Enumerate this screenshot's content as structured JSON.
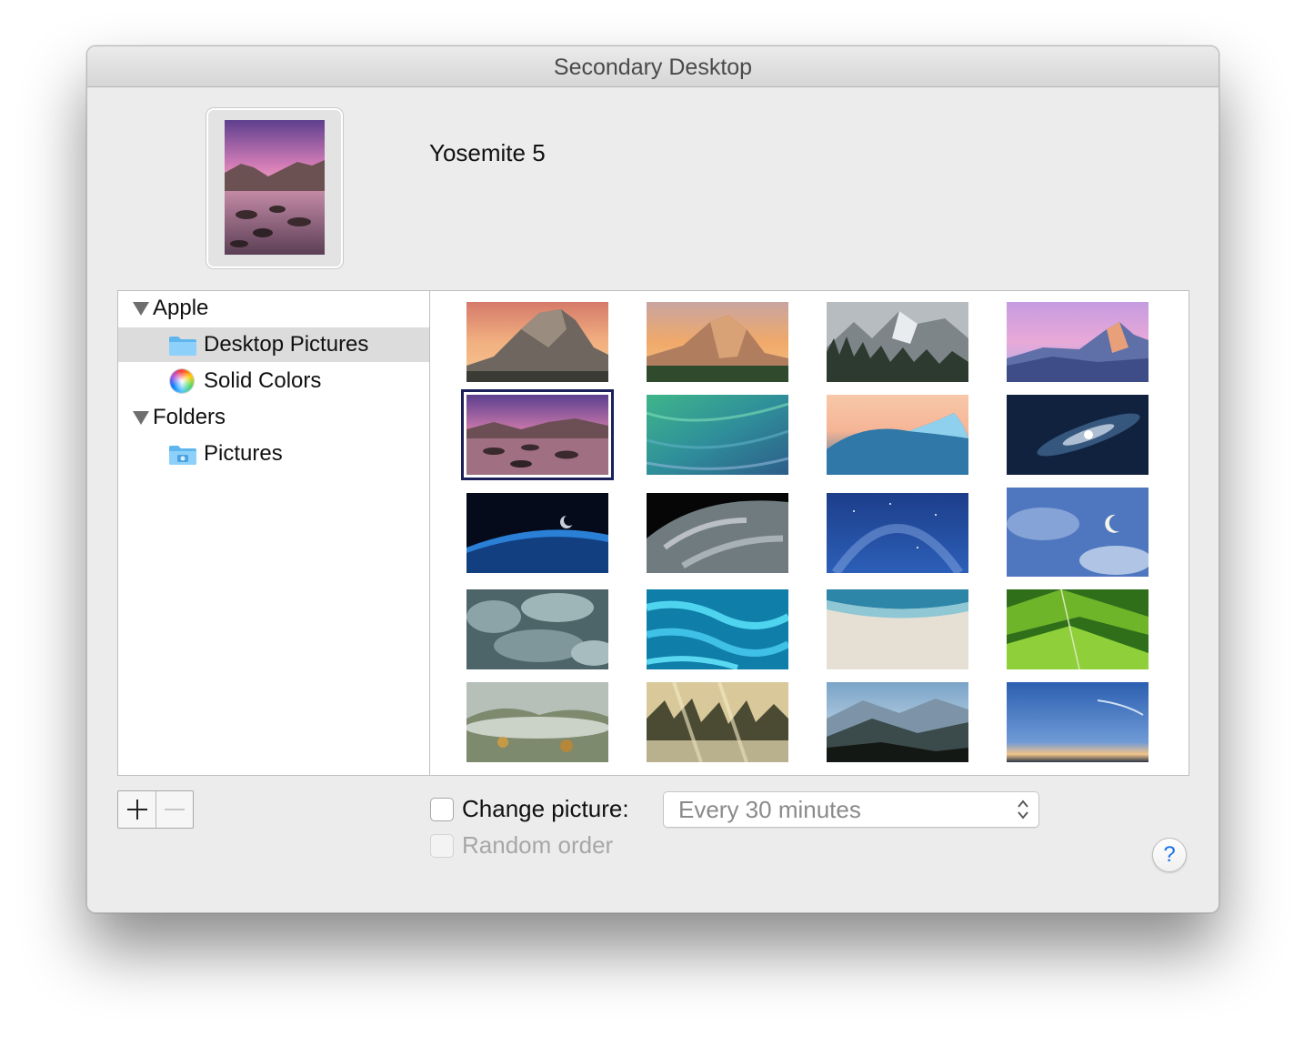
{
  "window": {
    "title": "Secondary Desktop"
  },
  "preview": {
    "name": "Yosemite 5"
  },
  "sources": [
    {
      "label": "Apple",
      "type": "group"
    },
    {
      "label": "Desktop Pictures",
      "type": "folder",
      "selected": true
    },
    {
      "label": "Solid Colors",
      "type": "colors"
    },
    {
      "label": "Folders",
      "type": "group"
    },
    {
      "label": "Pictures",
      "type": "folder"
    }
  ],
  "icons": {
    "disclosure": "disclosure-triangle-icon",
    "folder": "folder-icon",
    "pictures_folder": "pictures-folder-icon",
    "color_wheel": "color-wheel-icon",
    "add": "plus-icon",
    "remove": "minus-icon",
    "stepper": "up-down-arrows-icon"
  },
  "thumbnails": [
    {
      "theme": "yosemite-halfdome-sunset",
      "selected": false
    },
    {
      "theme": "yosemite-elcapitan-sunset",
      "selected": false
    },
    {
      "theme": "yosemite-snow-valley",
      "selected": false
    },
    {
      "theme": "yosemite-halfdome-purple",
      "selected": false
    },
    {
      "theme": "yosemite-lake-rocks",
      "selected": true
    },
    {
      "theme": "green-wave",
      "selected": false
    },
    {
      "theme": "blue-wave-sunset",
      "selected": false
    },
    {
      "theme": "galaxy",
      "selected": false
    },
    {
      "theme": "earth-horizon-moon",
      "selected": false
    },
    {
      "theme": "earth-clouds",
      "selected": false
    },
    {
      "theme": "milky-way-blue",
      "selected": false
    },
    {
      "theme": "moon-clouds",
      "selected": false
    },
    {
      "theme": "storm-clouds",
      "selected": false
    },
    {
      "theme": "turquoise-water",
      "selected": false
    },
    {
      "theme": "beach-shore",
      "selected": false
    },
    {
      "theme": "green-fields",
      "selected": false
    },
    {
      "theme": "foggy-forest",
      "selected": false
    },
    {
      "theme": "sunbeam-fog",
      "selected": false
    },
    {
      "theme": "misty-mountains",
      "selected": false
    },
    {
      "theme": "dusk-sky",
      "selected": false
    }
  ],
  "controls": {
    "change_picture": {
      "label": "Change picture:",
      "checked": false
    },
    "random_order": {
      "label": "Random order",
      "checked": false,
      "disabled": true
    },
    "interval": {
      "value": "Every 30 minutes"
    },
    "help": "?"
  },
  "colors": {
    "selection_border": "#1b1f5a",
    "source_selected": "#dcdcdc",
    "help_accent": "#1a73e8"
  }
}
